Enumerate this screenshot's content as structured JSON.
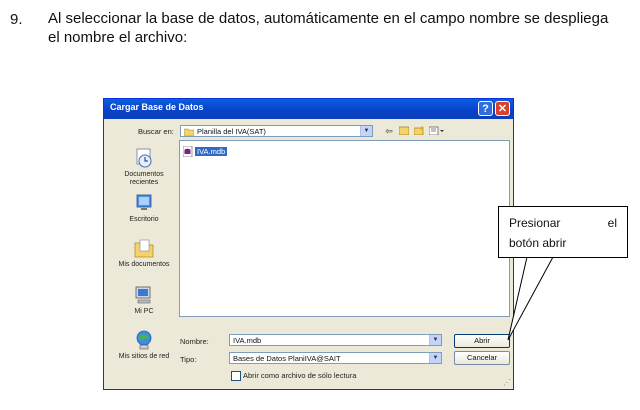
{
  "instruction": {
    "number": "9.",
    "text": "Al seleccionar la base de datos, automáticamente en el campo nombre se despliega el nombre el archivo:"
  },
  "dialog": {
    "title": "Cargar Base de Datos",
    "help_label": "?",
    "close_label": "✕",
    "look_in_label": "Buscar en:",
    "look_in_value": "Planilla del IVA(SAT)",
    "places": [
      {
        "label": "Documentos recientes",
        "icon": "recent-documents-icon"
      },
      {
        "label": "Escritorio",
        "icon": "desktop-icon"
      },
      {
        "label": "Mis documentos",
        "icon": "my-documents-icon"
      },
      {
        "label": "Mi PC",
        "icon": "my-computer-icon"
      },
      {
        "label": "Mis sitios de red",
        "icon": "network-places-icon"
      }
    ],
    "file": {
      "name": "IVA.mdb",
      "icon": "database-file-icon"
    },
    "name_label": "Nombre:",
    "name_value": "IVA.mdb",
    "type_label": "Tipo:",
    "type_value": "Bases de Datos PlaniIVA@SAIT",
    "open_button": "Abrir",
    "cancel_button": "Cancelar",
    "readonly_label": "Abrir como archivo de sólo lectura"
  },
  "callout": {
    "line1_a": "Presionar",
    "line1_b": "el",
    "line2": "botón abrir"
  }
}
